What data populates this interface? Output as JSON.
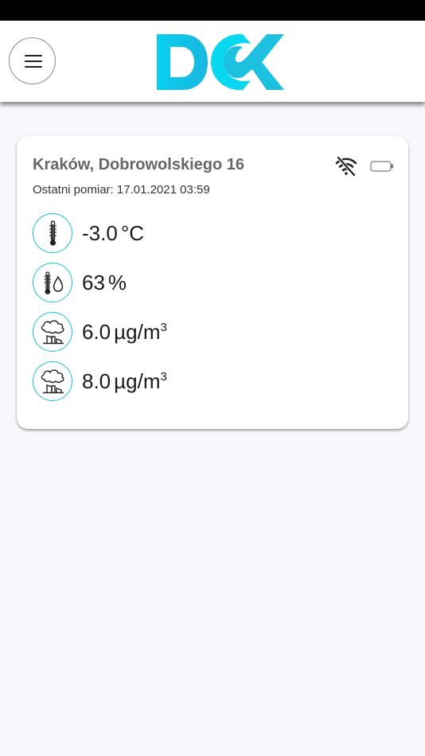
{
  "header": {
    "menu_icon": "hamburger-icon",
    "logo_text": "DCK",
    "brand_colors": [
      "#1ec0e0",
      "#08d6ef",
      "#1aa9d8"
    ]
  },
  "station": {
    "title": "Kraków, Dobrowolskiego 16",
    "last_measurement_label": "Ostatni pomiar:",
    "last_measurement_value": "17.01.2021 03:59",
    "status_icons": [
      "wifi-off-icon",
      "battery-empty-icon"
    ]
  },
  "readings": [
    {
      "icon": "thermometer-icon",
      "value": "-3.0",
      "unit": "°C",
      "sup": ""
    },
    {
      "icon": "humidity-icon",
      "value": "63",
      "unit": "%",
      "sup": ""
    },
    {
      "icon": "pollution-factory-icon",
      "value": "6.0",
      "unit": "µg/m",
      "sup": "3"
    },
    {
      "icon": "pollution-factory-icon",
      "value": "8.0",
      "unit": "µg/m",
      "sup": "3"
    }
  ],
  "colors": {
    "accent": "#1dc0d6",
    "page_background": "#f7f8fc",
    "card_background": "#ffffff",
    "title_text": "#666666"
  }
}
